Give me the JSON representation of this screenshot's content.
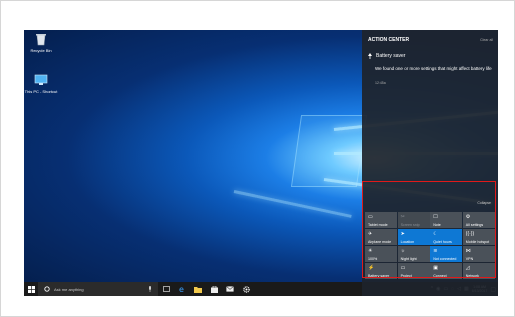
{
  "desktop": {
    "icons": [
      {
        "label": "Recycle Bin",
        "icon": "recycle-bin-icon"
      },
      {
        "label": "This PC - Shortcut",
        "icon": "computer-icon"
      }
    ]
  },
  "action_center": {
    "title": "ACTION CENTER",
    "clear_all": "Clear all",
    "notification": {
      "app": "Battery saver",
      "message": "We found one or more settings that might affect battery life",
      "time": "12:45a"
    },
    "collapse": "Collapse",
    "tiles": [
      {
        "label": "Tablet mode",
        "state": "off"
      },
      {
        "label": "Screen snip",
        "state": "dim"
      },
      {
        "label": "Note",
        "state": "off"
      },
      {
        "label": "All settings",
        "state": "off"
      },
      {
        "label": "Airplane mode",
        "state": "off"
      },
      {
        "label": "Location",
        "state": "on"
      },
      {
        "label": "Quiet hours",
        "state": "on"
      },
      {
        "label": "Mobile hotspot",
        "state": "off"
      },
      {
        "label": "100%",
        "state": "off"
      },
      {
        "label": "Night light",
        "state": "off"
      },
      {
        "label": "Not connected",
        "state": "on"
      },
      {
        "label": "VPN",
        "state": "off"
      },
      {
        "label": "Battery saver",
        "state": "off"
      },
      {
        "label": "Project",
        "state": "off"
      },
      {
        "label": "Connect",
        "state": "off"
      },
      {
        "label": "Network",
        "state": "off"
      }
    ]
  },
  "taskbar": {
    "search_placeholder": "Ask me anything",
    "apps": [
      "task-view-icon",
      "edge-icon",
      "file-explorer-icon",
      "store-icon",
      "mail-icon",
      "settings-icon"
    ],
    "clock_time": "1:08 AM",
    "clock_date": "6/13/2017"
  },
  "colors": {
    "accent": "#0e78d4",
    "highlight_border": "#e01a1a",
    "taskbar": "#1a1a1a"
  }
}
